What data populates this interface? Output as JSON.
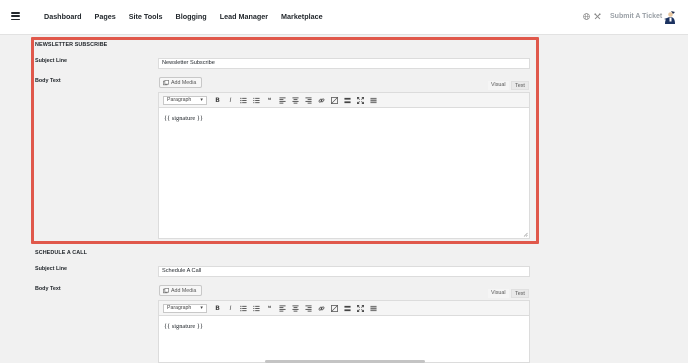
{
  "nav": {
    "items": [
      "Dashboard",
      "Pages",
      "Site Tools",
      "Blogging",
      "Lead Manager",
      "Marketplace"
    ],
    "submit_ticket": "Submit A Ticket"
  },
  "icons": {
    "menu": "hamburger-menu-icon",
    "globe": "globe-icon",
    "tools": "tools-icon",
    "avatar": "user-avatar"
  },
  "colors": {
    "highlight_border": "#e0584b",
    "topbar_bg": "#ffffff",
    "page_bg": "#f1f1f1"
  },
  "sections": [
    {
      "title": "NEWSLETTER SUBSCRIBE",
      "subject_label": "Subject Line",
      "subject_value": "Newsletter Subscribe",
      "body_label": "Body Text",
      "add_media": "Add Media",
      "tab_visual": "Visual",
      "tab_text": "Text",
      "format": "Paragraph",
      "body_content": "{{ signature }}"
    },
    {
      "title": "SCHEDULE A CALL",
      "subject_label": "Subject Line",
      "subject_value": "Schedule A Call",
      "body_label": "Body Text",
      "add_media": "Add Media",
      "tab_visual": "Visual",
      "tab_text": "Text",
      "format": "Paragraph",
      "body_content": "{{ signature }}"
    }
  ],
  "toolbar_buttons": [
    "bold",
    "italic",
    "bulleted-list",
    "numbered-list",
    "blockquote",
    "align-left",
    "align-center",
    "align-right",
    "insert-link",
    "remove-link",
    "read-more",
    "fullscreen",
    "toolbar-toggle"
  ]
}
